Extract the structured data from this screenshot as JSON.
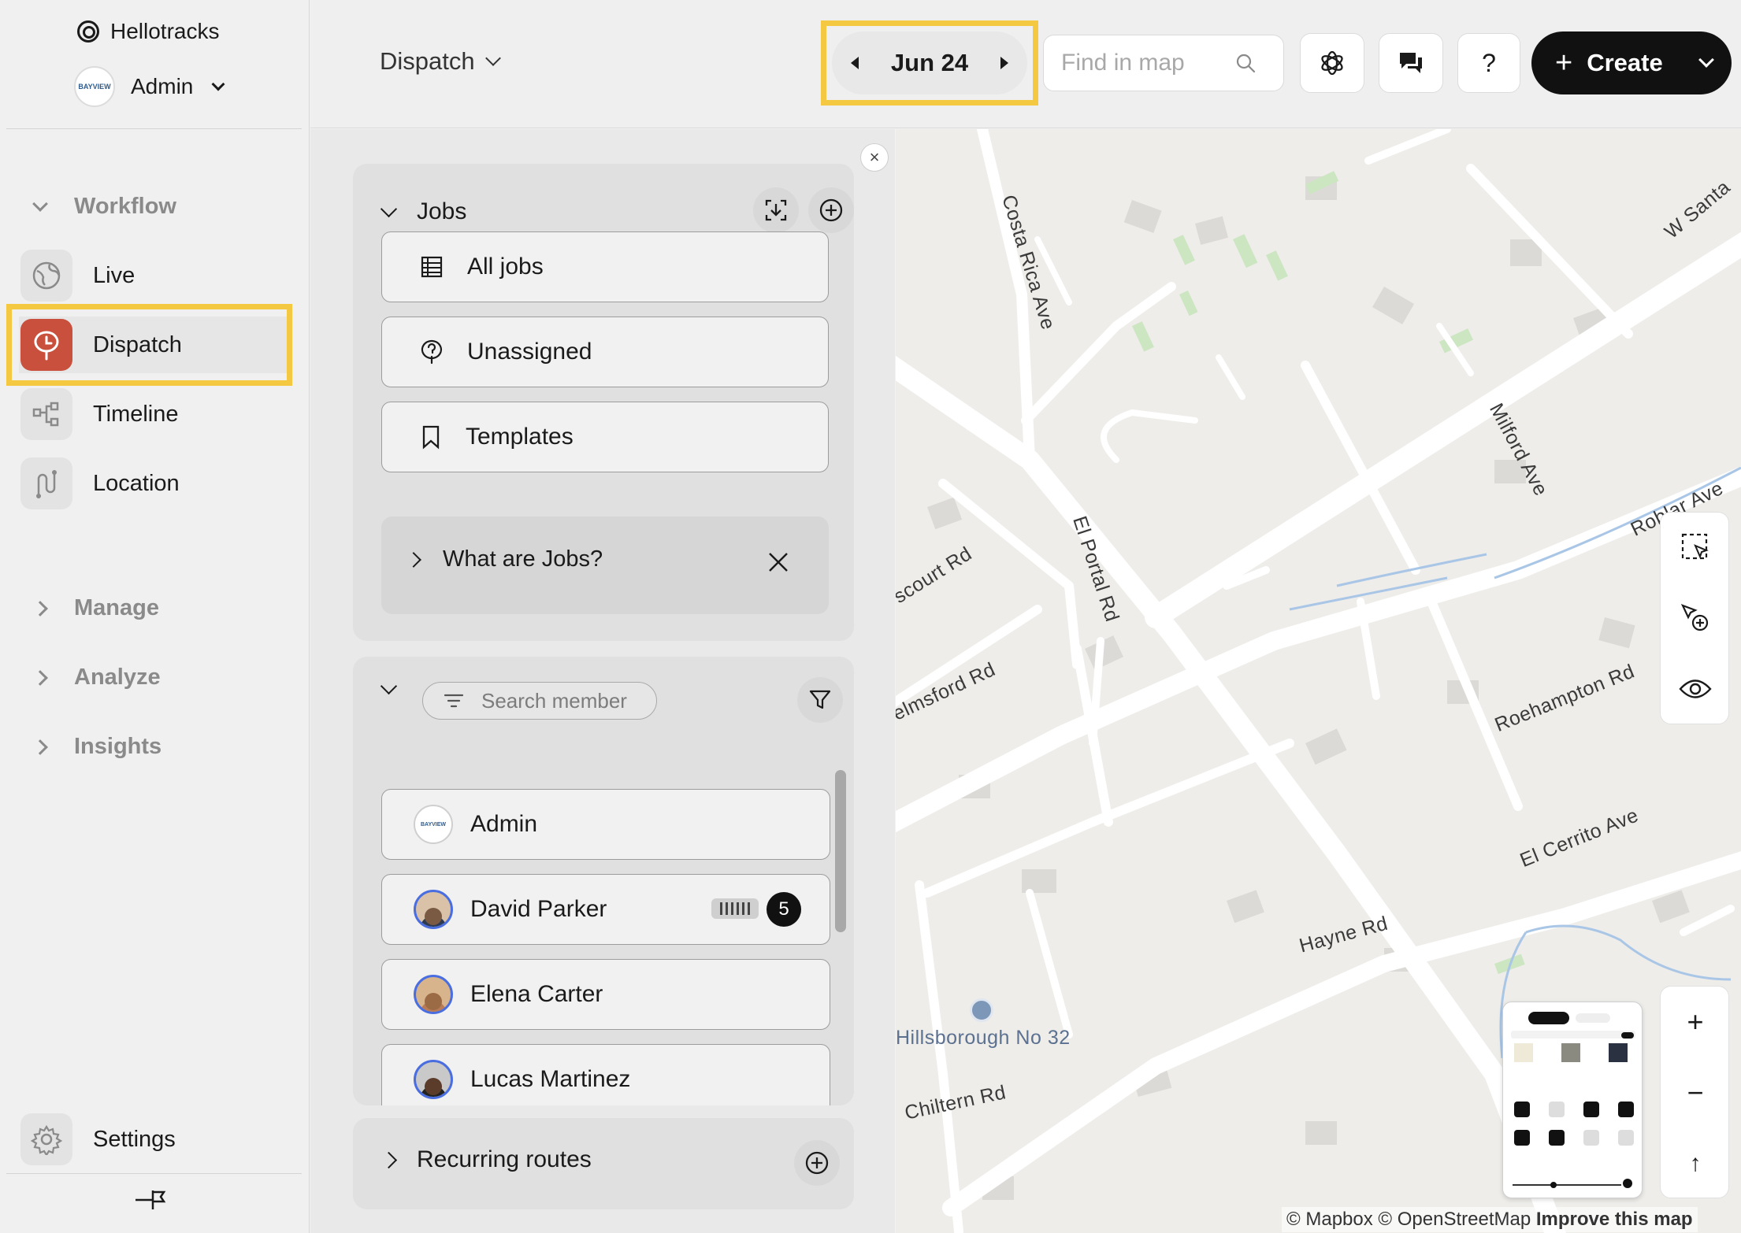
{
  "sidebar": {
    "brand": "Hellotracks",
    "account": {
      "name": "Admin",
      "logo_text": "BAYVIEW"
    },
    "workflow_label": "Workflow",
    "workflow_items": [
      {
        "label": "Live",
        "icon": "globe-icon"
      },
      {
        "label": "Dispatch",
        "icon": "dispatch-pin-icon",
        "active": true
      },
      {
        "label": "Timeline",
        "icon": "timeline-icon"
      },
      {
        "label": "Location",
        "icon": "route-icon"
      }
    ],
    "sections": [
      {
        "label": "Manage"
      },
      {
        "label": "Analyze"
      },
      {
        "label": "Insights"
      }
    ],
    "settings_label": "Settings"
  },
  "topbar": {
    "page_switch": "Dispatch",
    "date": "Jun 24",
    "find_placeholder": "Find in map",
    "help_label": "?",
    "create_label": "Create"
  },
  "jobs_panel": {
    "title": "Jobs",
    "rows": [
      {
        "label": "All jobs",
        "icon": "table-icon"
      },
      {
        "label": "Unassigned",
        "icon": "pin-question-icon"
      },
      {
        "label": "Templates",
        "icon": "bookmark-icon"
      }
    ],
    "help_label": "What are Jobs?"
  },
  "members_panel": {
    "search_placeholder": "Search member",
    "members": [
      {
        "name": "Admin",
        "logo_text": "BAYVIEW"
      },
      {
        "name": "David Parker",
        "job_count": "5"
      },
      {
        "name": "Elena Carter"
      },
      {
        "name": "Lucas Martinez"
      }
    ]
  },
  "recurring": {
    "title": "Recurring routes"
  },
  "map": {
    "streets": [
      "Costa Rica Ave",
      "W Santa",
      "Milford Ave",
      "Roblar Ave",
      "El Portal Rd",
      "scourt Rd",
      "elmsford Rd",
      "Roehampton Rd",
      "Hayne Rd",
      "El Cerrito Ave",
      "Chiltern Rd"
    ],
    "poi": "Hillsborough No 32",
    "attribution": "© Mapbox © OpenStreetMap",
    "improve": "Improve this map",
    "zoom_in": "+",
    "zoom_out": "−",
    "north": "↑"
  },
  "colors": {
    "highlight": "#f5c842",
    "dispatch_accent": "#c8503c",
    "avatar_ring": "#4a6ee0",
    "create_bg": "#111111"
  }
}
